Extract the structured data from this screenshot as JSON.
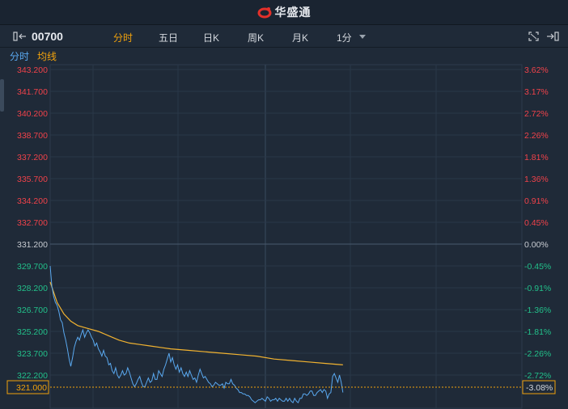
{
  "header": {
    "brand": "华盛通"
  },
  "toolbar": {
    "symbol": "00700",
    "periods": [
      "分时",
      "五日",
      "日K",
      "周K",
      "月K",
      "1分"
    ],
    "active": "分时"
  },
  "legend": {
    "line_label": "分时",
    "avg_label": "均线"
  },
  "chart_data": {
    "type": "line",
    "prev_close": 331.2,
    "current_price": "321.000",
    "current_pct": "-3.08%",
    "y_price_ticks": [
      "343.200",
      "341.700",
      "340.200",
      "338.700",
      "337.200",
      "335.700",
      "334.200",
      "332.700",
      "331.200",
      "329.700",
      "328.200",
      "326.700",
      "325.200",
      "323.700",
      "322.200"
    ],
    "y_pct_ticks": [
      "3.62%",
      "3.17%",
      "2.72%",
      "2.26%",
      "1.81%",
      "1.36%",
      "0.91%",
      "0.45%",
      "0.00%",
      "-0.45%",
      "-0.91%",
      "-1.36%",
      "-1.81%",
      "-2.26%",
      "-2.72%"
    ],
    "ylim": [
      320.7,
      343.2
    ],
    "x_count": 330,
    "price_points": [
      [
        0,
        329.7
      ],
      [
        2,
        328.3
      ],
      [
        4,
        327.6
      ],
      [
        6,
        327.2
      ],
      [
        8,
        327.0
      ],
      [
        10,
        326.6
      ],
      [
        12,
        326.0
      ],
      [
        14,
        325.8
      ],
      [
        16,
        325.1
      ],
      [
        18,
        324.6
      ],
      [
        20,
        324.0
      ],
      [
        22,
        323.3
      ],
      [
        24,
        322.8
      ],
      [
        26,
        323.4
      ],
      [
        28,
        324.1
      ],
      [
        30,
        324.5
      ],
      [
        32,
        324.8
      ],
      [
        34,
        324.6
      ],
      [
        36,
        325.0
      ],
      [
        38,
        325.3
      ],
      [
        40,
        324.8
      ],
      [
        42,
        325.1
      ],
      [
        44,
        325.3
      ],
      [
        46,
        325.1
      ],
      [
        48,
        324.8
      ],
      [
        50,
        324.6
      ],
      [
        52,
        324.2
      ],
      [
        54,
        324.4
      ],
      [
        56,
        324.0
      ],
      [
        58,
        323.8
      ],
      [
        60,
        323.5
      ],
      [
        62,
        323.9
      ],
      [
        64,
        323.5
      ],
      [
        66,
        323.4
      ],
      [
        68,
        322.9
      ],
      [
        70,
        323.0
      ],
      [
        72,
        322.5
      ],
      [
        74,
        322.3
      ],
      [
        76,
        322.7
      ],
      [
        78,
        322.2
      ],
      [
        80,
        322.0
      ],
      [
        82,
        322.2
      ],
      [
        84,
        322.5
      ],
      [
        86,
        322.2
      ],
      [
        88,
        322.3
      ],
      [
        90,
        322.7
      ],
      [
        92,
        322.4
      ],
      [
        94,
        322.0
      ],
      [
        96,
        321.6
      ],
      [
        98,
        321.4
      ],
      [
        100,
        321.6
      ],
      [
        102,
        321.9
      ],
      [
        104,
        322.1
      ],
      [
        106,
        321.7
      ],
      [
        108,
        321.4
      ],
      [
        110,
        321.4
      ],
      [
        112,
        321.7
      ],
      [
        114,
        322.0
      ],
      [
        116,
        321.7
      ],
      [
        118,
        321.8
      ],
      [
        120,
        322.3
      ],
      [
        122,
        321.9
      ],
      [
        124,
        321.9
      ],
      [
        126,
        322.5
      ],
      [
        128,
        322.3
      ],
      [
        130,
        322.1
      ],
      [
        132,
        322.6
      ],
      [
        134,
        322.9
      ],
      [
        136,
        323.3
      ],
      [
        138,
        323.7
      ],
      [
        140,
        323.1
      ],
      [
        142,
        323.4
      ],
      [
        144,
        322.9
      ],
      [
        146,
        322.6
      ],
      [
        148,
        322.9
      ],
      [
        150,
        322.4
      ],
      [
        152,
        322.7
      ],
      [
        154,
        322.3
      ],
      [
        156,
        322.1
      ],
      [
        158,
        322.4
      ],
      [
        160,
        322.1
      ],
      [
        162,
        322.5
      ],
      [
        164,
        322.2
      ],
      [
        166,
        321.9
      ],
      [
        168,
        322.0
      ],
      [
        170,
        321.7
      ],
      [
        172,
        322.2
      ],
      [
        174,
        322.6
      ],
      [
        176,
        322.3
      ],
      [
        178,
        322.0
      ],
      [
        180,
        322.1
      ],
      [
        182,
        321.9
      ],
      [
        184,
        321.7
      ],
      [
        186,
        321.6
      ],
      [
        188,
        321.4
      ],
      [
        190,
        321.5
      ],
      [
        192,
        321.7
      ],
      [
        194,
        321.6
      ],
      [
        196,
        321.5
      ],
      [
        198,
        321.5
      ],
      [
        200,
        321.6
      ],
      [
        202,
        321.3
      ],
      [
        204,
        321.7
      ],
      [
        206,
        321.6
      ],
      [
        208,
        321.6
      ],
      [
        210,
        321.9
      ],
      [
        212,
        321.6
      ],
      [
        214,
        321.5
      ],
      [
        216,
        321.3
      ],
      [
        218,
        321.2
      ],
      [
        220,
        321.0
      ],
      [
        222,
        321.0
      ],
      [
        224,
        320.9
      ],
      [
        226,
        320.9
      ],
      [
        228,
        320.8
      ],
      [
        230,
        320.8
      ],
      [
        232,
        320.7
      ],
      [
        234,
        320.5
      ],
      [
        236,
        320.4
      ],
      [
        238,
        320.3
      ],
      [
        240,
        320.4
      ],
      [
        242,
        320.5
      ],
      [
        244,
        320.5
      ],
      [
        246,
        320.6
      ],
      [
        248,
        320.5
      ],
      [
        250,
        320.4
      ],
      [
        252,
        320.7
      ],
      [
        254,
        320.6
      ],
      [
        256,
        320.4
      ],
      [
        258,
        320.5
      ],
      [
        260,
        320.5
      ],
      [
        262,
        320.6
      ],
      [
        264,
        320.4
      ],
      [
        266,
        320.6
      ],
      [
        268,
        320.5
      ],
      [
        270,
        320.4
      ],
      [
        272,
        320.4
      ],
      [
        274,
        320.6
      ],
      [
        276,
        320.4
      ],
      [
        278,
        320.6
      ],
      [
        280,
        320.4
      ],
      [
        282,
        320.3
      ],
      [
        284,
        320.6
      ],
      [
        286,
        320.4
      ],
      [
        288,
        320.3
      ],
      [
        290,
        320.6
      ],
      [
        292,
        320.6
      ],
      [
        294,
        320.9
      ],
      [
        296,
        320.9
      ],
      [
        298,
        320.8
      ],
      [
        300,
        320.9
      ],
      [
        302,
        321.1
      ],
      [
        304,
        321.1
      ],
      [
        306,
        320.8
      ],
      [
        308,
        320.8
      ],
      [
        310,
        321.0
      ],
      [
        312,
        321.1
      ],
      [
        314,
        321.2
      ],
      [
        316,
        321.0
      ],
      [
        318,
        321.2
      ],
      [
        320,
        321.1
      ],
      [
        322,
        320.6
      ],
      [
        324,
        320.9
      ],
      [
        326,
        321.0
      ],
      [
        328,
        322.1
      ],
      [
        330,
        322.3
      ],
      [
        332,
        322.0
      ],
      [
        334,
        321.7
      ],
      [
        336,
        322.2
      ],
      [
        338,
        321.7
      ],
      [
        340,
        321.0
      ]
    ],
    "avg_points": [
      [
        0,
        328.6
      ],
      [
        8,
        327.2
      ],
      [
        16,
        326.4
      ],
      [
        24,
        325.9
      ],
      [
        32,
        325.6
      ],
      [
        44,
        325.4
      ],
      [
        56,
        325.2
      ],
      [
        68,
        324.9
      ],
      [
        80,
        324.6
      ],
      [
        92,
        324.4
      ],
      [
        104,
        324.3
      ],
      [
        116,
        324.2
      ],
      [
        128,
        324.1
      ],
      [
        140,
        324.0
      ],
      [
        160,
        323.9
      ],
      [
        180,
        323.8
      ],
      [
        200,
        323.7
      ],
      [
        220,
        323.6
      ],
      [
        240,
        323.5
      ],
      [
        260,
        323.3
      ],
      [
        280,
        323.2
      ],
      [
        300,
        323.1
      ],
      [
        320,
        323.0
      ],
      [
        340,
        322.9
      ]
    ],
    "colors": {
      "line": "#5aa9f0",
      "avg": "#f2b330",
      "up": "#f0424a",
      "down": "#22c08a",
      "neutral": "#c8ccd2"
    }
  }
}
